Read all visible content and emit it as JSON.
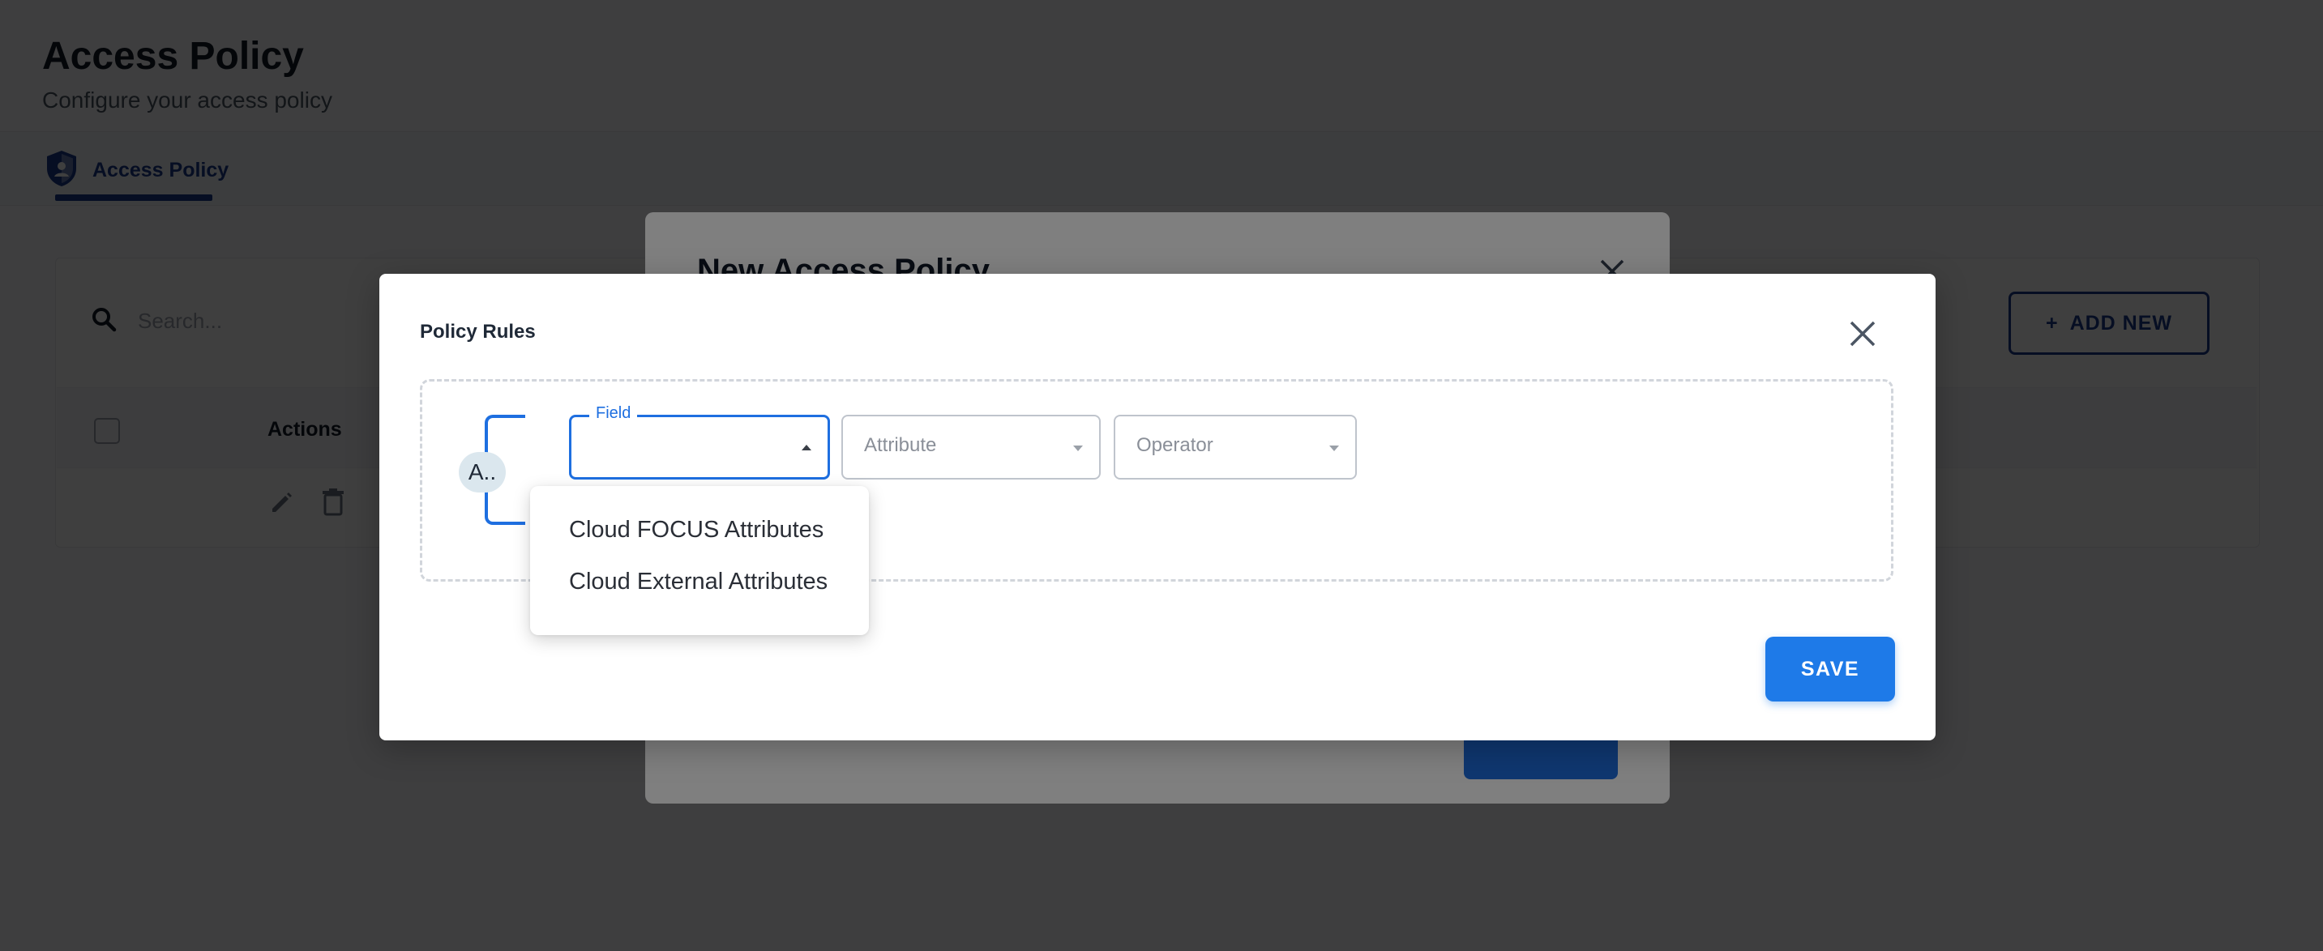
{
  "page": {
    "title": "Access Policy",
    "subtitle": "Configure your access policy"
  },
  "tabs": [
    {
      "label": "Access Policy",
      "icon": "shield-icon",
      "active": true
    }
  ],
  "toolbar": {
    "search_placeholder": "Search...",
    "add_new_label": "ADD NEW",
    "add_new_icon": "plus-icon"
  },
  "table": {
    "columns": [
      "Actions"
    ],
    "row_actions": [
      "edit-icon",
      "delete-icon"
    ]
  },
  "new_policy_dialog": {
    "title": "New Access Policy"
  },
  "policy_rules_dialog": {
    "title": "Policy Rules",
    "group_chip": "A..",
    "field_select": {
      "label": "Field",
      "value": "",
      "open": true
    },
    "attribute_select": {
      "placeholder": "Attribute"
    },
    "operator_select": {
      "placeholder": "Operator"
    },
    "field_options": [
      "Cloud FOCUS Attributes",
      "Cloud External Attributes"
    ],
    "save_label": "SAVE"
  },
  "colors": {
    "primary": "#1e6fe0",
    "brand_dark": "#1b3a8c",
    "overlay": "rgba(0,0,0,0.5)"
  }
}
